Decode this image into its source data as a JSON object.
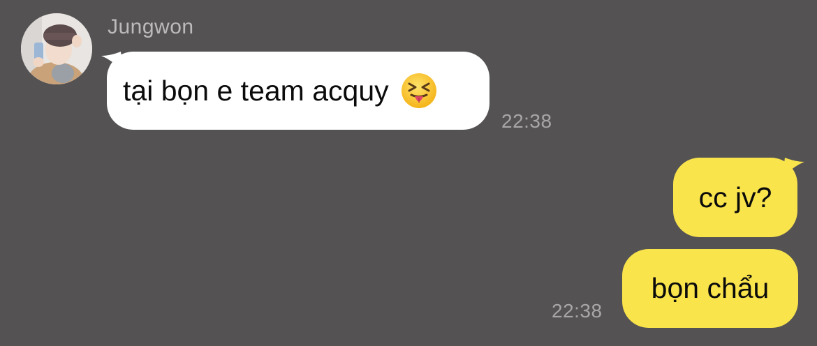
{
  "conversation": {
    "incoming": {
      "sender": "Jungwon",
      "text": "tại bọn e team acquy",
      "emoji": "squinting-face-with-tongue",
      "time": "22:38"
    },
    "outgoing": [
      {
        "text": "cc jv?"
      },
      {
        "text": "bọn chẩu",
        "time": "22:38"
      }
    ]
  },
  "colors": {
    "background": "#545253",
    "incoming_bubble": "#ffffff",
    "outgoing_bubble": "#f9e44c",
    "meta_text": "#a9a6a7"
  }
}
